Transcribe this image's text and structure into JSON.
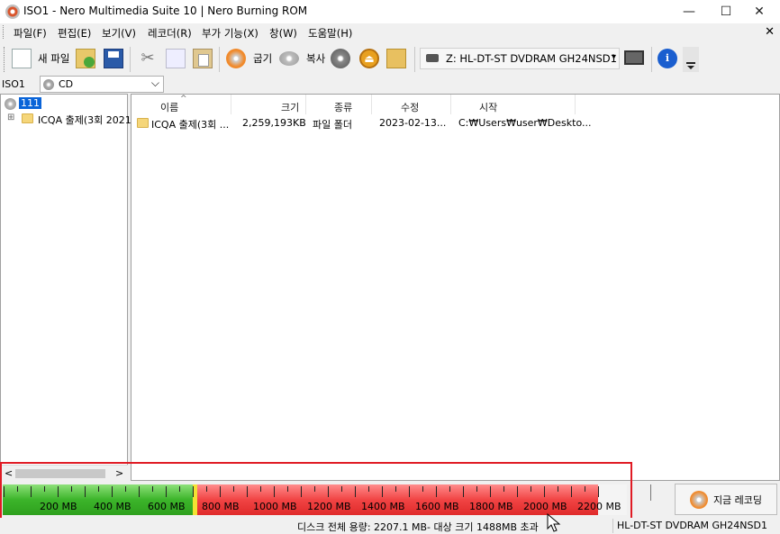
{
  "window": {
    "title": "ISO1 - Nero Multimedia Suite 10 | Nero Burning ROM",
    "minimize": "—",
    "maximize": "☐",
    "close": "✕"
  },
  "menu": {
    "items": [
      "파일(F)",
      "편집(E)",
      "보기(V)",
      "레코더(R)",
      "부가 기능(X)",
      "창(W)",
      "도움말(H)"
    ],
    "mdi_close": "✕"
  },
  "toolbar": {
    "new_label": "새 파일",
    "burn_label": "굽기",
    "copy_label": "복사",
    "drive": "Z: HL-DT-ST DVDRAM GH24NSD1",
    "drive_arrow": "▾"
  },
  "compile": {
    "label": "ISO1",
    "type": "CD",
    "arrow": "⌵"
  },
  "tree": {
    "root": "111",
    "expander": "⊞",
    "child": "ICQA 출제(3회 2021"
  },
  "columns": {
    "name": "이름",
    "size": "크기",
    "type": "종류",
    "modified": "수정",
    "origin": "시작"
  },
  "files": [
    {
      "name": "ICQA 출제(3회 ...",
      "size": "2,259,193KB",
      "type": "파일 폴더",
      "modified": "2023-02-13...",
      "origin": "C:₩Users₩user₩Deskto..."
    }
  ],
  "scroll": {
    "left_arrow": "<",
    "right_arrow": ">"
  },
  "capacity": {
    "labels": [
      "200 MB",
      "400 MB",
      "600 MB",
      "800 MB",
      "1000 MB",
      "1200 MB",
      "1400 MB",
      "1600 MB",
      "1800 MB",
      "2000 MB",
      "2200 MB"
    ],
    "used_mb": 2207.1,
    "target_mb": 1488,
    "status": "디스크 전체 용량: 2207.1 MB- 대상 크기 1488MB 초과",
    "colors": {
      "ok": "#3cb42a",
      "over": "#f14444",
      "frame": "#e01b24"
    }
  },
  "burn_now_label": "지금 레코딩",
  "status_drive": "HL-DT-ST DVDRAM GH24NSD1"
}
